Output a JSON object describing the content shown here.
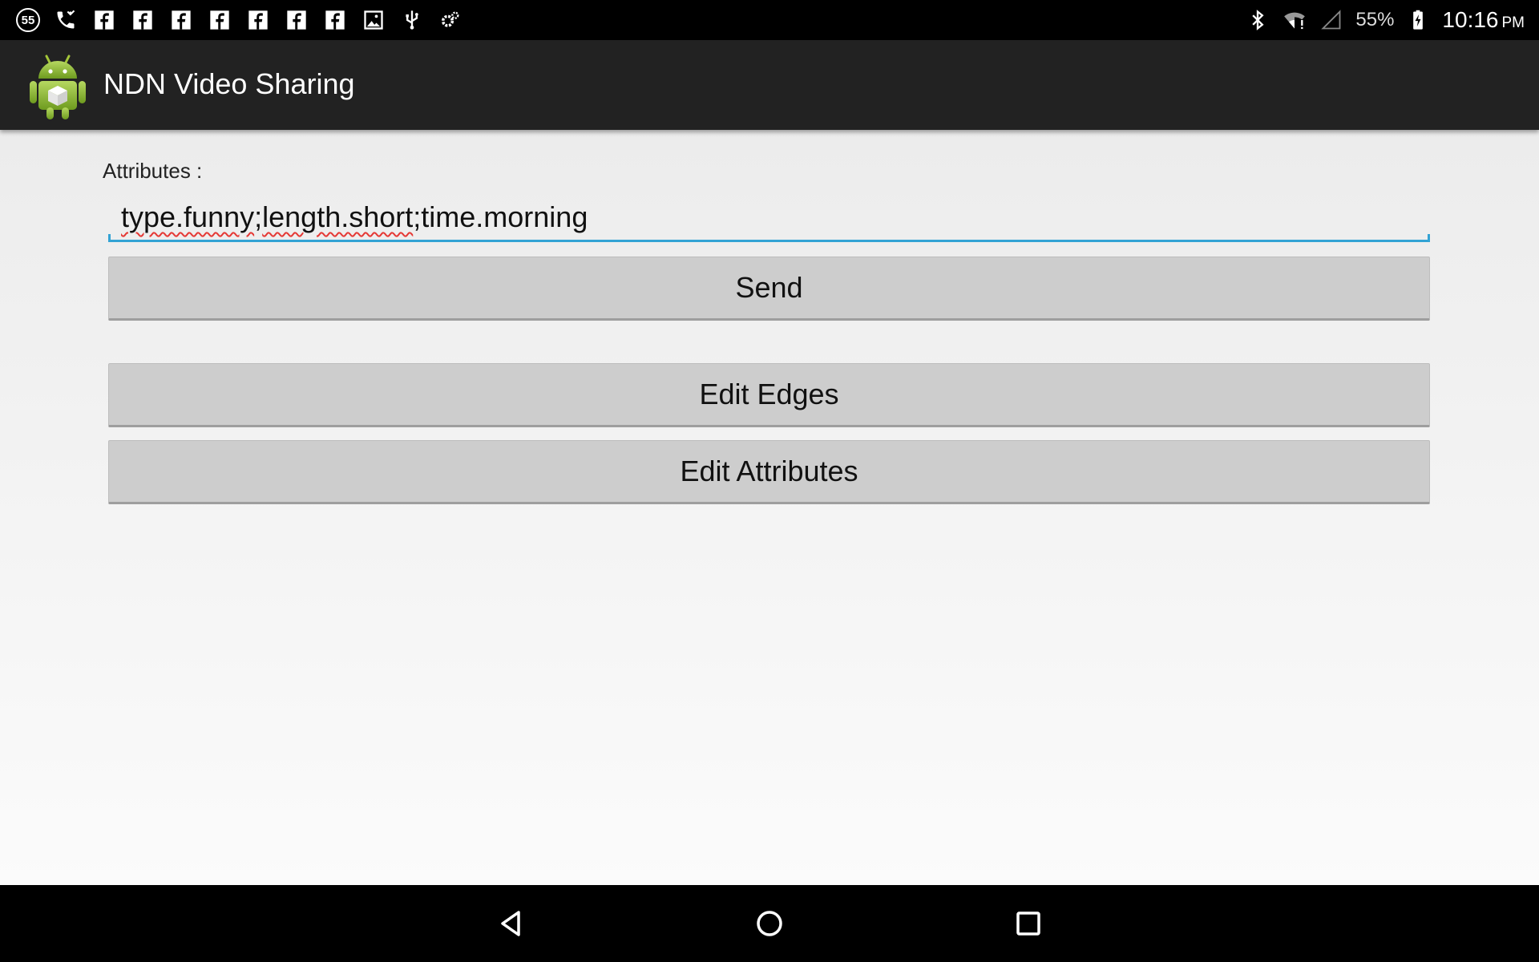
{
  "status_bar": {
    "notification_count": "55",
    "battery_percent": "55%",
    "time": "10:16",
    "time_suffix": "PM",
    "left_icons": [
      "missed-call-icon",
      "facebook-icon",
      "facebook-icon",
      "facebook-icon",
      "facebook-icon",
      "facebook-icon",
      "facebook-icon",
      "gallery-icon",
      "usb-icon",
      "settings-icon"
    ],
    "right_icons": [
      "bluetooth-icon",
      "wifi-alert-icon",
      "no-signal-icon",
      "battery-charging-icon"
    ]
  },
  "action_bar": {
    "title": "NDN Video Sharing",
    "icon": "android-app-icon"
  },
  "form": {
    "attributes_label": "Attributes :",
    "attributes_value_parts": [
      "type.funny",
      ";",
      "length.short",
      ";time.morning"
    ],
    "accent_color": "#33a3d4"
  },
  "buttons": {
    "send": "Send",
    "edit_edges": "Edit Edges",
    "edit_attributes": "Edit Attributes"
  },
  "nav_bar": {
    "icons": [
      "back-icon",
      "home-icon",
      "recent-apps-icon"
    ]
  }
}
